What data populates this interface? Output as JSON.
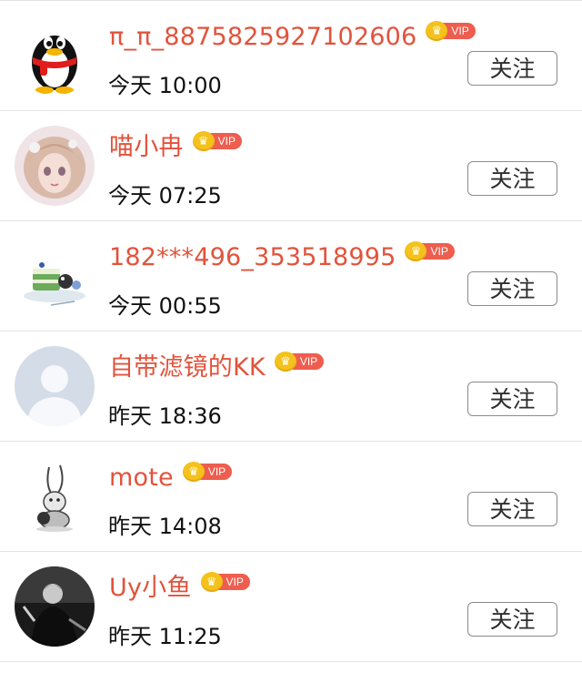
{
  "colors": {
    "name": "#e2533c",
    "time": "#111111",
    "vip_crown": "#f4c21b",
    "vip_tag": "#ee5d4e",
    "divider": "#e3e3e3",
    "button_border": "#8b8b8b"
  },
  "users": [
    {
      "name": "π_π_8875825927102606",
      "vip_label": "VIP",
      "time": "今天 10:00",
      "follow_label": "关注",
      "avatar_icon": "qq-penguin-avatar"
    },
    {
      "name": "喵小冉",
      "vip_label": "VIP",
      "time": "今天 07:25",
      "follow_label": "关注",
      "avatar_icon": "anime-girl-avatar"
    },
    {
      "name": "182***496_353518995",
      "vip_label": "VIP",
      "time": "今天 00:55",
      "follow_label": "关注",
      "avatar_icon": "cake-avatar"
    },
    {
      "name": "自带滤镜的KK",
      "vip_label": "VIP",
      "time": "昨天 18:36",
      "follow_label": "关注",
      "avatar_icon": "default-person-avatar"
    },
    {
      "name": "mote",
      "vip_label": "VIP",
      "time": "昨天 14:08",
      "follow_label": "关注",
      "avatar_icon": "rabbit-sketch-avatar"
    },
    {
      "name": "Uy小鱼",
      "vip_label": "VIP",
      "time": "昨天 11:25",
      "follow_label": "关注",
      "avatar_icon": "man-portrait-avatar"
    }
  ]
}
